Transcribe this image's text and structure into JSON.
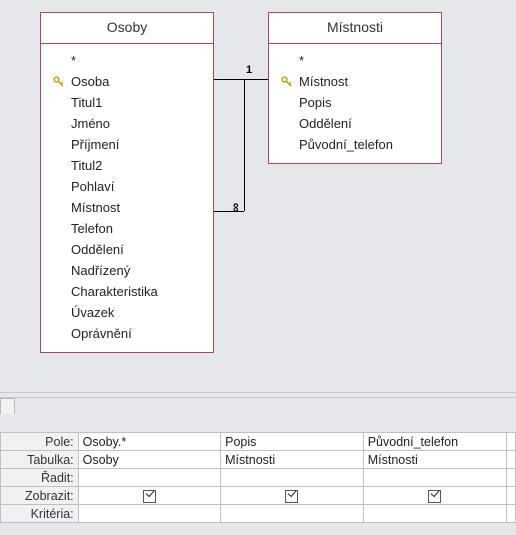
{
  "tables": {
    "osoby": {
      "title": "Osoby",
      "star": "*",
      "fields": [
        "Osoba",
        "Titul1",
        "Jméno",
        "Příjmení",
        "Titul2",
        "Pohlaví",
        "Místnost",
        "Telefon",
        "Oddělení",
        "Nadřízený",
        "Charakteristika",
        "Úvazek",
        "Oprávnění"
      ],
      "pk_index": 0
    },
    "mistnosti": {
      "title": "Místnosti",
      "star": "*",
      "fields": [
        "Místnost",
        "Popis",
        "Oddělení",
        "Původní_telefon"
      ],
      "pk_index": 0
    }
  },
  "relationship": {
    "left_label": "1",
    "right_label": "∞"
  },
  "grid": {
    "row_labels": {
      "field": "Pole:",
      "table": "Tabulka:",
      "sort": "Řadit:",
      "show": "Zobrazit:",
      "criteria": "Kritéria:"
    },
    "columns": [
      {
        "field": "Osoby.*",
        "table": "Osoby",
        "sort": "",
        "show": true,
        "criteria": ""
      },
      {
        "field": "Popis",
        "table": "Místnosti",
        "sort": "",
        "show": true,
        "criteria": ""
      },
      {
        "field": "Původní_telefon",
        "table": "Místnosti",
        "sort": "",
        "show": true,
        "criteria": ""
      }
    ]
  }
}
